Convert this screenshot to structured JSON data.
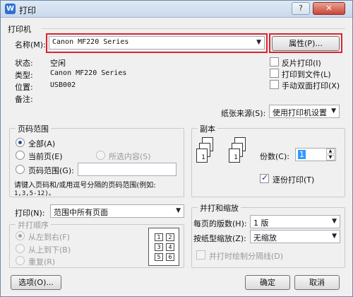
{
  "window": {
    "title": "打印",
    "app_icon": "W"
  },
  "printer": {
    "group_title": "打印机",
    "name_label": "名称(M):",
    "name_value": "Canon MF220 Series",
    "properties_button": "属性(P)...",
    "status_label": "状态:",
    "status_value": "空闲",
    "type_label": "类型:",
    "type_value": "Canon MF220 Series",
    "location_label": "位置:",
    "location_value": "USB002",
    "comment_label": "备注:",
    "reverse_print": "反片打印(I)",
    "print_to_file": "打印到文件(L)",
    "manual_duplex": "手动双面打印(X)",
    "paper_source_label": "纸张来源(S):",
    "paper_source_value": "使用打印机设置"
  },
  "page_range": {
    "group_title": "页码范围",
    "all": "全部(A)",
    "current_page": "当前页(E)",
    "selection": "所选内容(S)",
    "pages": "页码范围(G):",
    "pages_value": "",
    "hint_line1": "请键入页码和/或用逗号分隔的页码范围(例如:",
    "hint_line2": "1,3,5-12)。"
  },
  "copies": {
    "group_title": "副本",
    "count_label": "份数(C):",
    "count_value": "1",
    "collate": "逐份打印(T)"
  },
  "print_what": {
    "label": "打印(N):",
    "value": "范围中所有页面"
  },
  "print_order": {
    "group_title": "并打顺序",
    "left_to_right": "从左到右(F)",
    "top_to_bottom": "从上到下(B)",
    "repeat": "重复(R)",
    "grid": [
      "1",
      "2",
      "3",
      "4",
      "5",
      "6"
    ]
  },
  "zoom": {
    "group_title": "并打和缩放",
    "pages_per_sheet_label": "每页的版数(H):",
    "pages_per_sheet_value": "1 版",
    "scale_label": "按纸型缩放(Z):",
    "scale_value": "无缩放",
    "draw_lines": "并打时绘制分隔线(D)"
  },
  "footer": {
    "options_button": "选项(O)...",
    "ok_button": "确定",
    "cancel_button": "取消"
  },
  "colors": {
    "highlight": "#d8252f"
  }
}
